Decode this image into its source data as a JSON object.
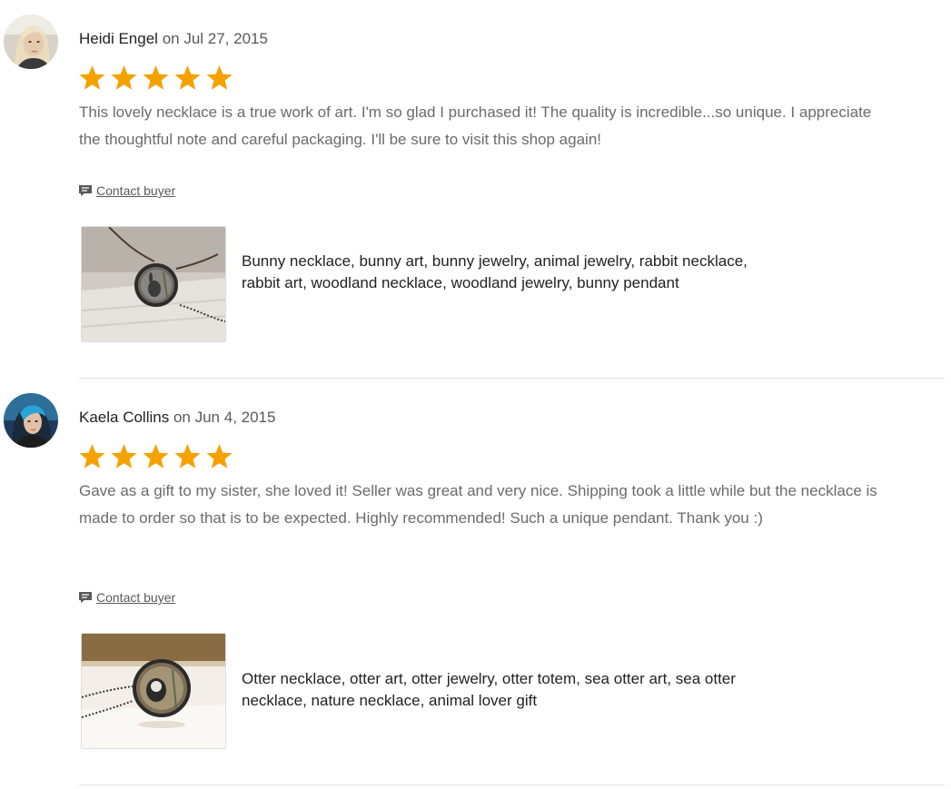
{
  "reviews": [
    {
      "author": "Heidi Engel",
      "date": "on Jul 27, 2015",
      "rating": 5,
      "text": "This lovely necklace is a true work of art. I'm so glad I purchased it! The quality is incredible...so unique. I appreciate the thoughtful note and careful packaging. I'll be sure to visit this shop again!",
      "contact_label": "Contact buyer",
      "listing_title": "Bunny necklace, bunny art, bunny jewelry, animal jewelry, rabbit necklace, rabbit art, woodland necklace, woodland jewelry, bunny pendant"
    },
    {
      "author": "Kaela Collins",
      "date": "on Jun 4, 2015",
      "rating": 5,
      "text": "Gave as a gift to my sister, she loved it! Seller was great and very nice. Shipping took a little while but the necklace is made to order so that is to be expected. Highly recommended! Such a unique pendant. Thank you :)",
      "contact_label": "Contact buyer",
      "listing_title": "Otter necklace, otter art, otter jewelry, otter totem, sea otter art, sea otter necklace, nature necklace, animal lover gift"
    }
  ],
  "colors": {
    "star": "#f5a200",
    "author": "#222222",
    "date": "#595959",
    "body_text": "#6b6b6b",
    "divider": "#e1e1e1"
  },
  "icons": {
    "star": "star-icon",
    "contact": "speech-bubble-icon"
  }
}
